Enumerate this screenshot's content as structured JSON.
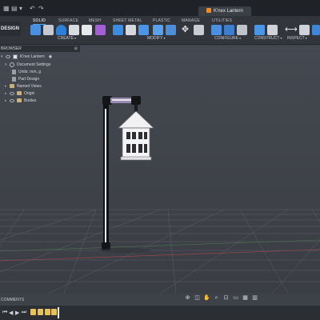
{
  "window": {
    "tab_title": "K'nex Lantern"
  },
  "ribbon": {
    "design_label": "DESIGN",
    "tabs": [
      "SOLID",
      "SURFACE",
      "MESH",
      "SHEET METAL",
      "PLASTIC",
      "MANAGE",
      "UTILITIES"
    ],
    "active_tab": "SOLID",
    "groups": [
      "CREATE",
      "MODIFY",
      "CONFIGURE",
      "CONSTRUCT",
      "INSPECT"
    ]
  },
  "browser": {
    "title": "BROWSER",
    "root": "K'nex Lantern",
    "items": [
      "Document Settings",
      "Units: mm, g",
      "Part Design",
      "Named Views",
      "Origin",
      "Bodies"
    ]
  },
  "bottom": {
    "comments_label": "COMMENTS"
  },
  "colors": {
    "accent": "#4aa3ff",
    "brand": "#f28a24",
    "background": "#3d4148"
  }
}
